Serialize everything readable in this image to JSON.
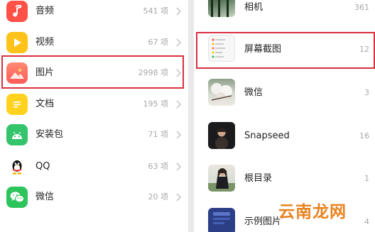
{
  "left_list": [
    {
      "label": "音频",
      "count": "541 项",
      "icon": "music-note-icon",
      "color": "#ff5147"
    },
    {
      "label": "视频",
      "count": "67 项",
      "icon": "play-icon",
      "color": "#ffc21a"
    },
    {
      "label": "图片",
      "count": "2998 项",
      "icon": "landscape-image-icon",
      "color": "#ff6b5e"
    },
    {
      "label": "文档",
      "count": "195 项",
      "icon": "document-icon",
      "color": "#ffd21f"
    },
    {
      "label": "安装包",
      "count": "71 项",
      "icon": "android-icon",
      "color": "#34c46b"
    },
    {
      "label": "QQ",
      "count": "63 项",
      "icon": "qq-penguin-icon",
      "color": "#ffffff"
    },
    {
      "label": "微信",
      "count": "20 项",
      "icon": "wechat-icon",
      "color": "#2ec45c"
    }
  ],
  "right_list": [
    {
      "label": "相机",
      "count": "361"
    },
    {
      "label": "屏幕截图",
      "count": "12"
    },
    {
      "label": "微信",
      "count": "3"
    },
    {
      "label": "Snapseed",
      "count": "16"
    },
    {
      "label": "根目录",
      "count": "1"
    },
    {
      "label": "示例图片",
      "count": "4"
    }
  ],
  "watermark": "云南龙网",
  "highlight_color": "#d9303f"
}
